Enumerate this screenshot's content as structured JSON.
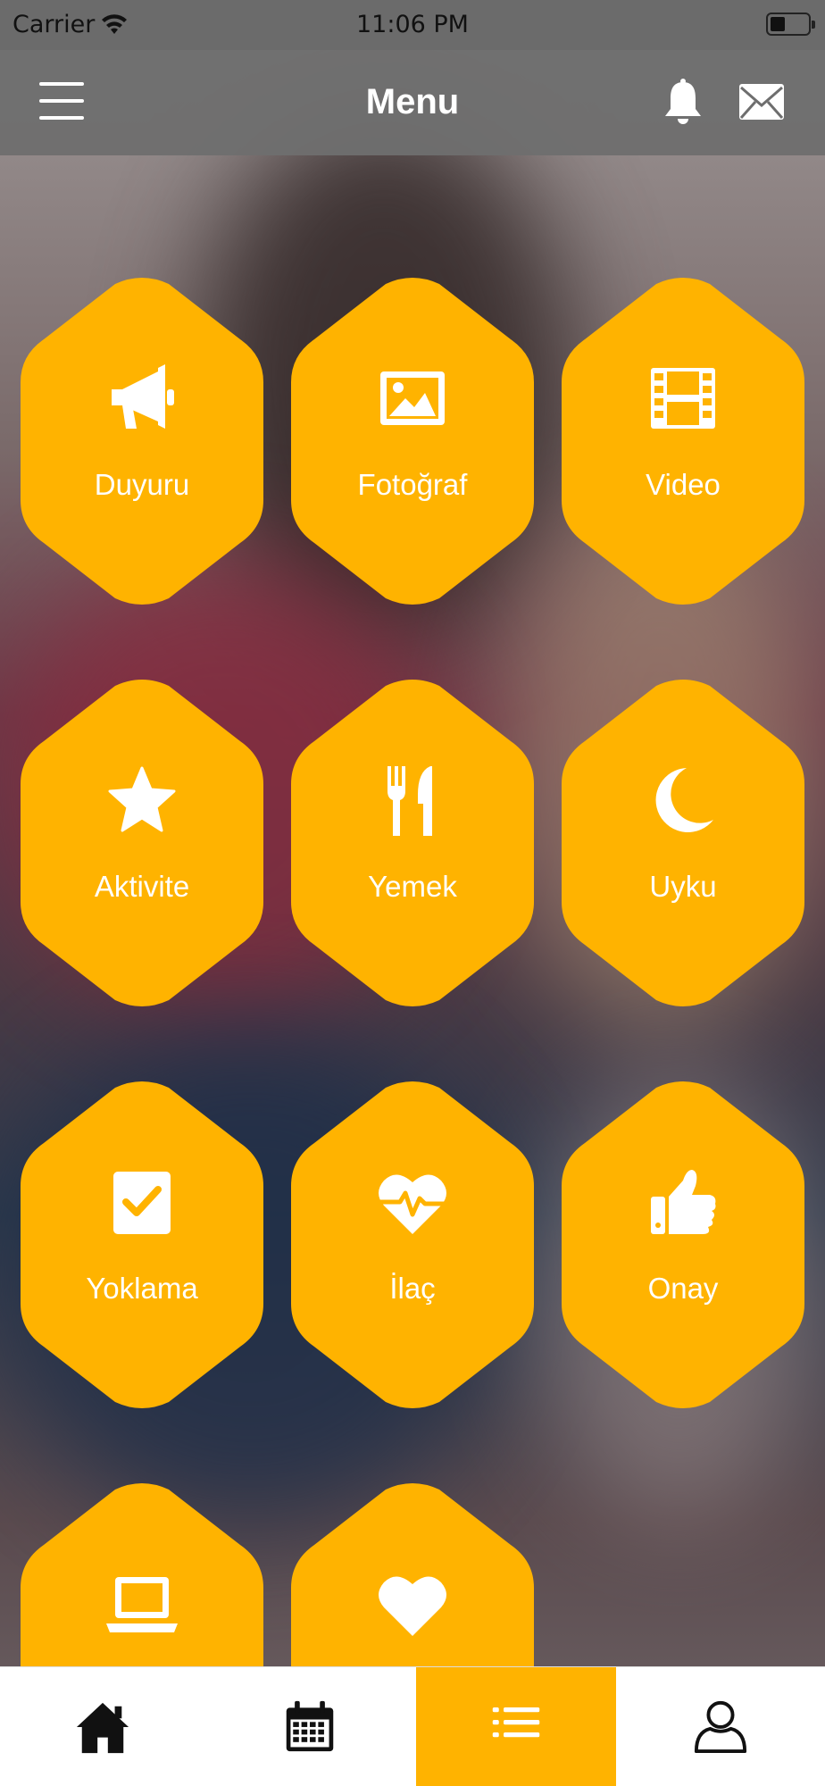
{
  "status_bar": {
    "carrier": "Carrier",
    "time": "11:06 PM"
  },
  "header": {
    "title": "Menu",
    "icons": [
      "hamburger-menu-icon",
      "bell-icon",
      "mail-icon"
    ]
  },
  "menu_items": [
    {
      "label": "Duyuru",
      "icon": "megaphone-icon"
    },
    {
      "label": "Fotoğraf",
      "icon": "image-icon"
    },
    {
      "label": "Video",
      "icon": "film-icon"
    },
    {
      "label": "Aktivite",
      "icon": "star-icon"
    },
    {
      "label": "Yemek",
      "icon": "fork-knife-icon"
    },
    {
      "label": "Uyku",
      "icon": "moon-icon"
    },
    {
      "label": "Yoklama",
      "icon": "checkbox-icon"
    },
    {
      "label": "İlaç",
      "icon": "heartbeat-icon"
    },
    {
      "label": "Onay",
      "icon": "thumbs-up-icon"
    },
    {
      "label": "",
      "icon": "laptop-icon"
    },
    {
      "label": "",
      "icon": "heart-icon"
    }
  ],
  "tab_bar": {
    "tabs": [
      {
        "icon": "home-icon",
        "active": false
      },
      {
        "icon": "calendar-icon",
        "active": false
      },
      {
        "icon": "list-icon",
        "active": true
      },
      {
        "icon": "user-icon",
        "active": false
      }
    ]
  },
  "colors": {
    "accent": "#ffb300",
    "header_bg": "#6e6e6e",
    "icon_white": "#ffffff"
  }
}
